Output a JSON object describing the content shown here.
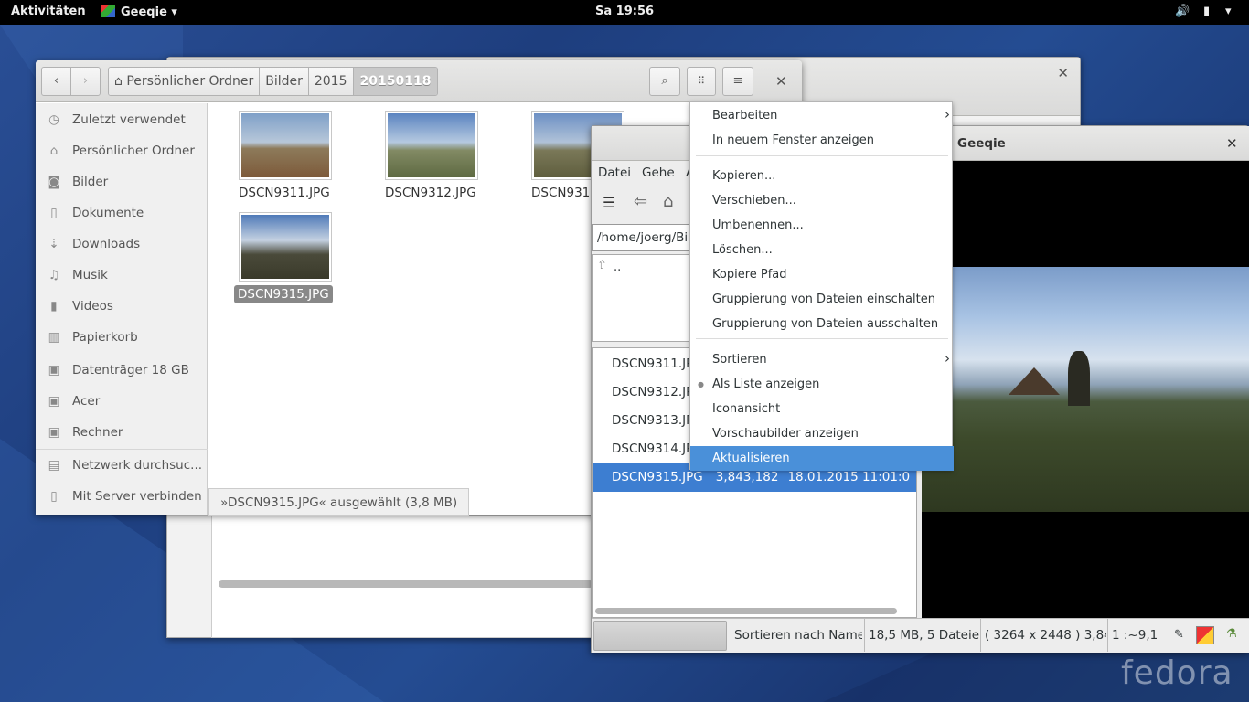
{
  "topbar": {
    "activities": "Aktivitäten",
    "app_menu": "Geeqie",
    "clock": "Sa 19:56"
  },
  "nautilus": {
    "breadcrumbs": [
      "Persönlicher Ordner",
      "Bilder",
      "2015",
      "20150118"
    ],
    "sidebar": [
      {
        "label": "Zuletzt verwendet",
        "icon": "clock-icon"
      },
      {
        "label": "Persönlicher Ordner",
        "icon": "home-icon"
      },
      {
        "label": "Bilder",
        "icon": "camera-icon"
      },
      {
        "label": "Dokumente",
        "icon": "document-icon"
      },
      {
        "label": "Downloads",
        "icon": "download-icon"
      },
      {
        "label": "Musik",
        "icon": "music-icon"
      },
      {
        "label": "Videos",
        "icon": "video-icon"
      },
      {
        "label": "Papierkorb",
        "icon": "trash-icon"
      },
      {
        "label": "Datenträger 18 GB",
        "icon": "drive-icon"
      },
      {
        "label": "Acer",
        "icon": "drive-icon"
      },
      {
        "label": "Rechner",
        "icon": "drive-icon"
      },
      {
        "label": "Netzwerk durchsuc...",
        "icon": "network-icon"
      },
      {
        "label": "Mit Server verbinden",
        "icon": "server-icon"
      }
    ],
    "files": [
      "DSCN9311.JPG",
      "DSCN9312.JPG",
      "DSCN931",
      "DSCN9315.JPG"
    ],
    "status": "»DSCN9315.JPG« ausgewählt  (3,8 MB)"
  },
  "geeqie": {
    "title": "Geeqie",
    "menubar": [
      "Datei",
      "Gehe",
      "A"
    ],
    "path": "/home/joerg/Bild",
    "parent_dir": "..",
    "files": [
      {
        "name": "DSCN9311.JPG",
        "size": "",
        "date": ""
      },
      {
        "name": "DSCN9312.JPG",
        "size": "",
        "date": ""
      },
      {
        "name": "DSCN9313.JPG",
        "size": "",
        "date": ""
      },
      {
        "name": "DSCN9314.JPG",
        "size": "",
        "date": ""
      },
      {
        "name": "DSCN9315.JPG",
        "size": "3,843,182",
        "date": "18.01.2015 11:01:0"
      }
    ],
    "statusbar": {
      "sort": "Sortieren nach Name",
      "total": "18,5 MB, 5 Dateien",
      "dims": "( 3264 x 2448 ) 3,84",
      "zoom": "1 :~9,1"
    },
    "selection_color": "#3d7ed1"
  },
  "context_menu": {
    "items": [
      {
        "label": "Bearbeiten",
        "submenu": true
      },
      {
        "label": "In neuem Fenster anzeigen"
      },
      {
        "label": "Kopieren..."
      },
      {
        "label": "Verschieben..."
      },
      {
        "label": "Umbenennen..."
      },
      {
        "label": "Löschen..."
      },
      {
        "label": "Kopiere Pfad"
      },
      {
        "label": "Gruppierung von Dateien einschalten"
      },
      {
        "label": "Gruppierung von Dateien ausschalten"
      },
      {
        "label": "Sortieren",
        "submenu": true
      },
      {
        "label": "Als Liste anzeigen",
        "radio": true
      },
      {
        "label": "Iconansicht"
      },
      {
        "label": "Vorschaubilder anzeigen"
      },
      {
        "label": "Aktualisieren",
        "highlighted": true
      }
    ],
    "highlight_color": "#4a90d9"
  },
  "watermark": "fedora"
}
